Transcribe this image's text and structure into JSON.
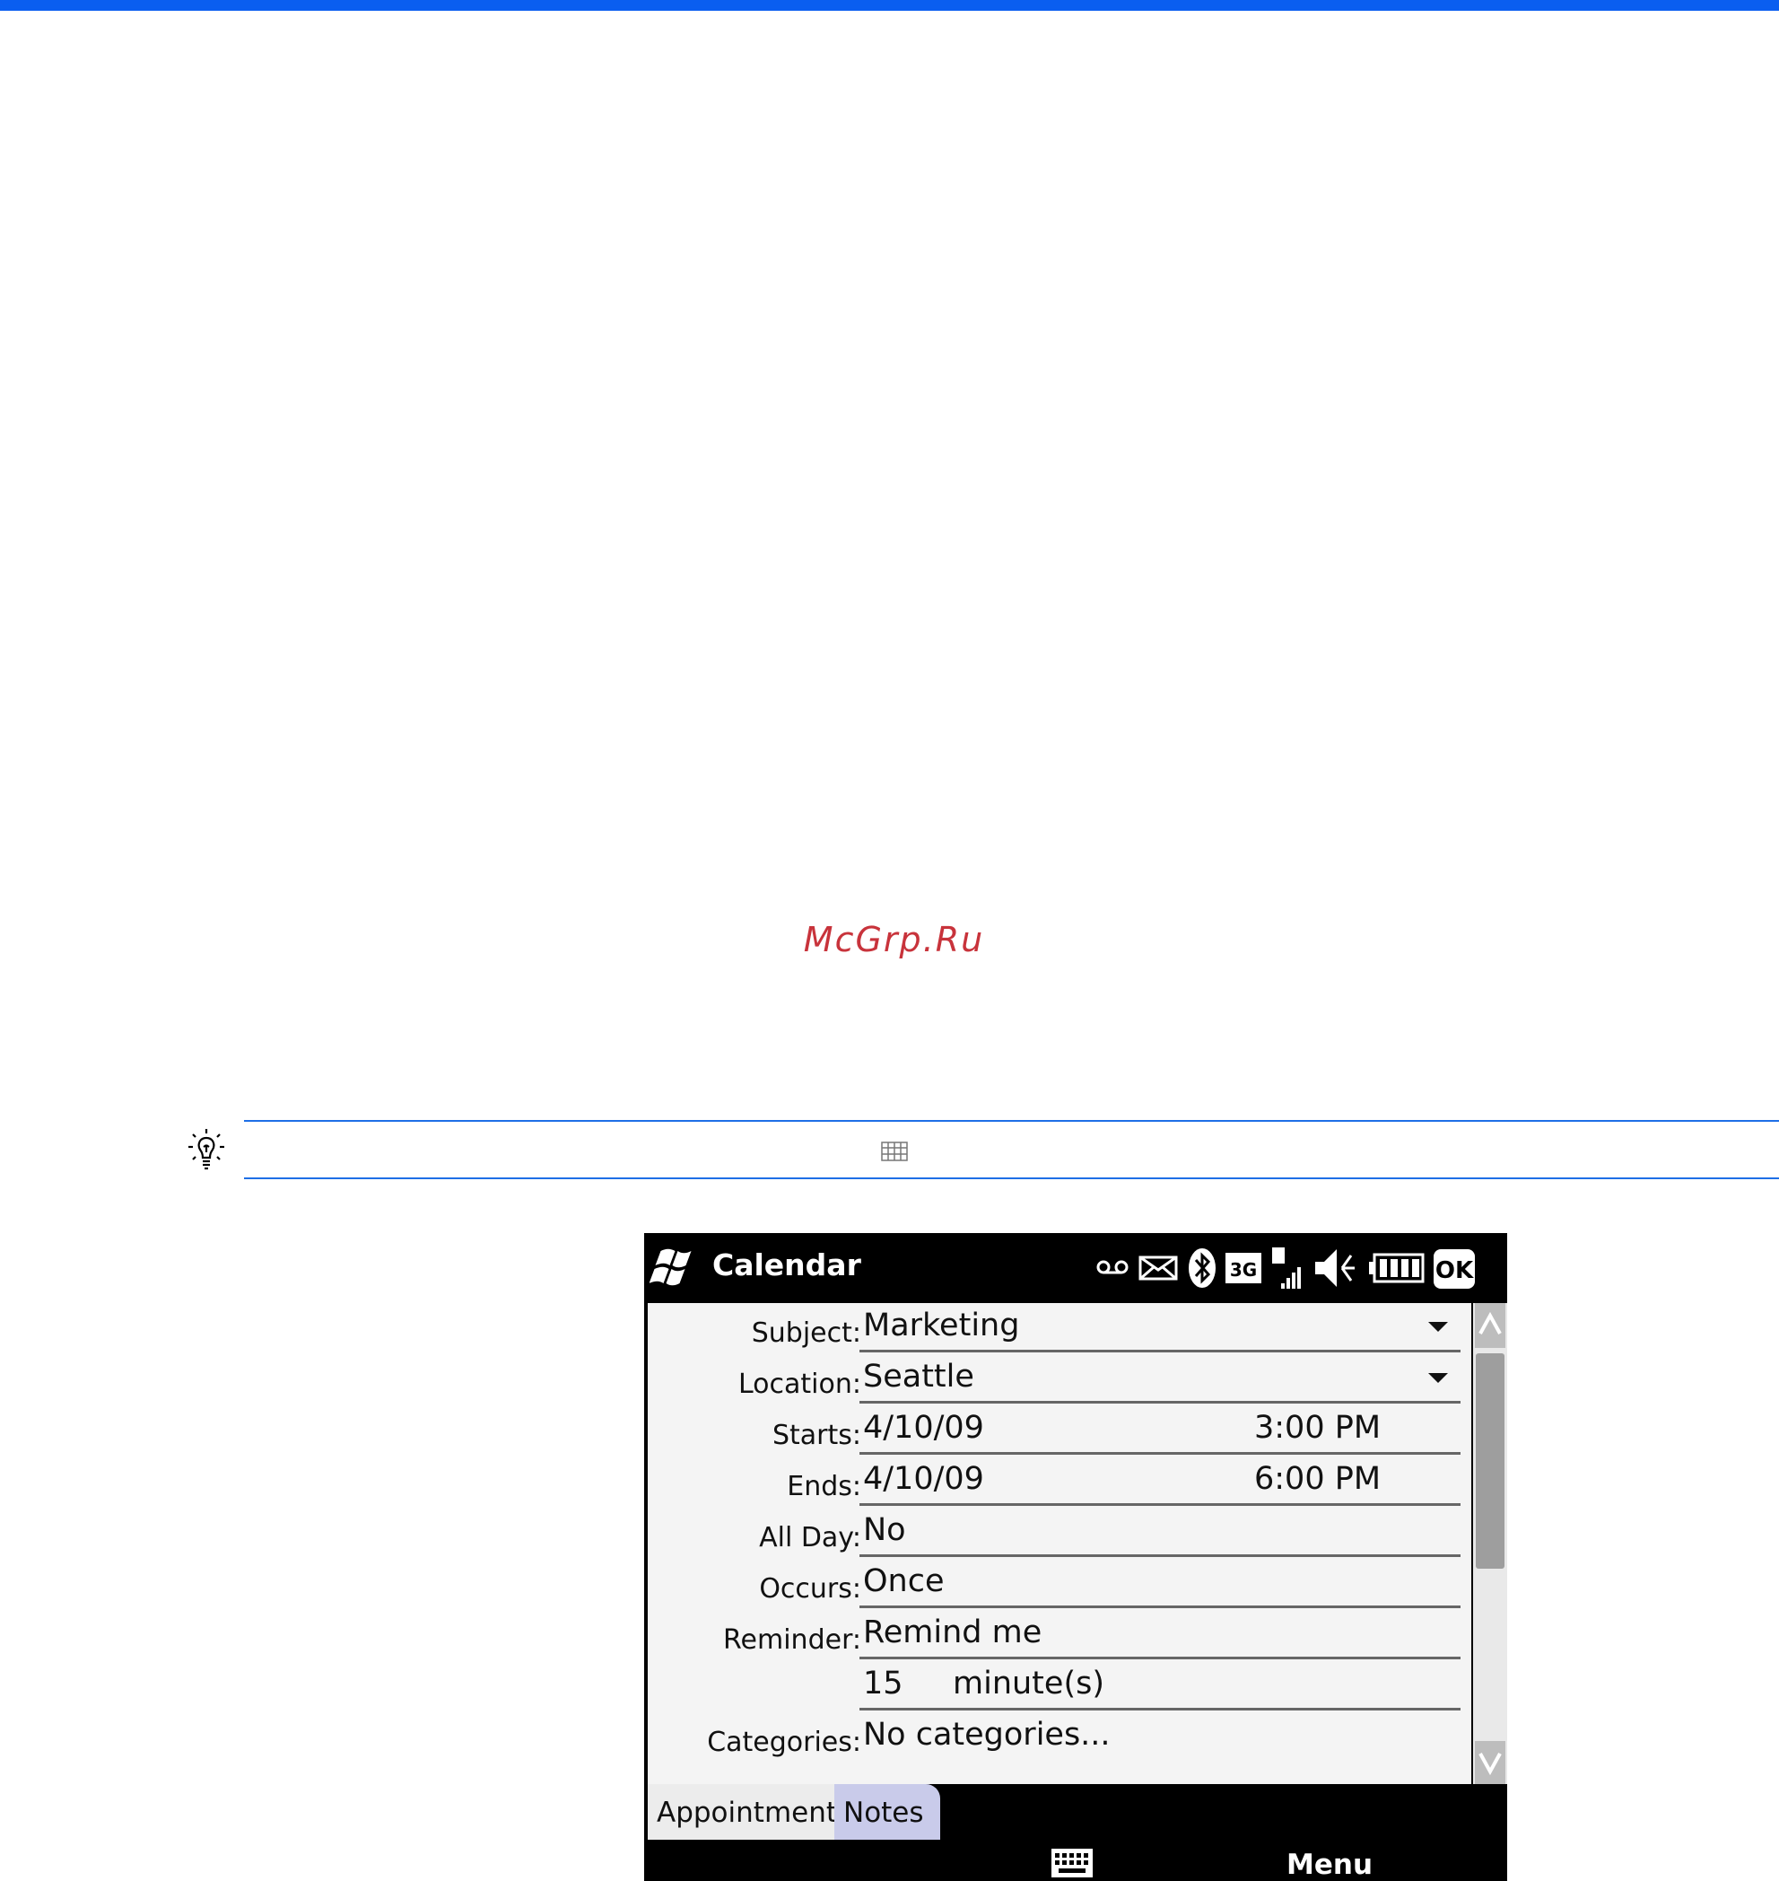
{
  "watermark": "McGrp.Ru",
  "device": {
    "app_title": "Calendar",
    "status_icons": [
      "voicemail-icon",
      "envelope-icon",
      "bluetooth-icon",
      "3g-icon",
      "signal-icon",
      "speaker-mute-icon",
      "battery-icon",
      "ok-button"
    ],
    "ok_label": "OK",
    "network_label": "3G",
    "form": {
      "subject": {
        "label": "Subject:",
        "value": "Marketing"
      },
      "location": {
        "label": "Location:",
        "value": "Seattle"
      },
      "starts": {
        "label": "Starts:",
        "date": "4/10/09",
        "time": "3:00 PM"
      },
      "ends": {
        "label": "Ends:",
        "date": "4/10/09",
        "time": "6:00 PM"
      },
      "all_day": {
        "label": "All Day:",
        "value": "No"
      },
      "occurs": {
        "label": "Occurs:",
        "value": "Once"
      },
      "reminder": {
        "label": "Reminder:",
        "value": "Remind me",
        "amount": "15",
        "unit": "minute(s)"
      },
      "categories": {
        "label": "Categories:",
        "value": "No categories..."
      }
    },
    "tabs": [
      "Appointment",
      "Notes"
    ],
    "softkey_right": "Menu"
  },
  "colors": {
    "accent_blue": "#0a5ef0",
    "watermark_red": "#c8333b",
    "notes_tab": "#c9cbea"
  }
}
